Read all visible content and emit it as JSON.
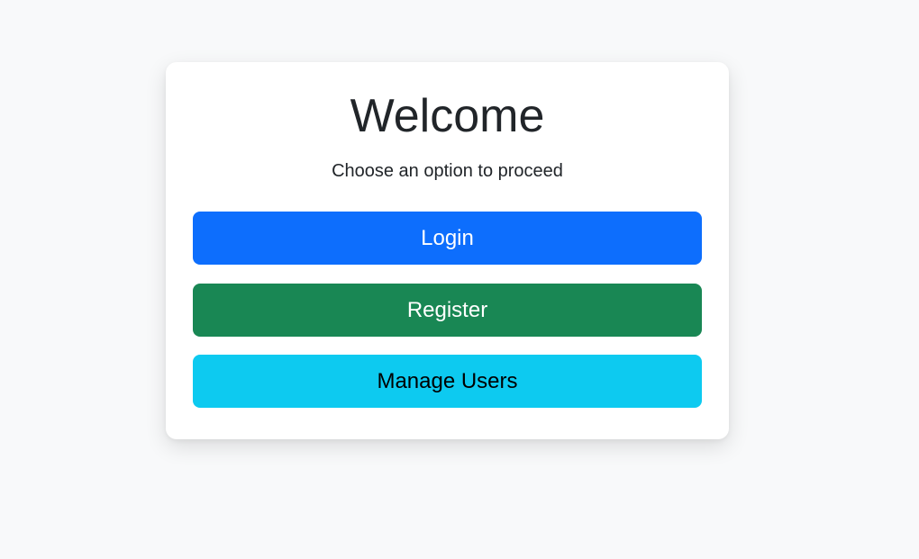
{
  "card": {
    "title": "Welcome",
    "subtitle": "Choose an option to proceed"
  },
  "actions": {
    "login_label": "Login",
    "register_label": "Register",
    "manage_users_label": "Manage Users"
  },
  "colors": {
    "page_background": "#f8f9fa",
    "login": "#0d6efd",
    "register": "#198754",
    "manage_users": "#0dcaf0"
  }
}
